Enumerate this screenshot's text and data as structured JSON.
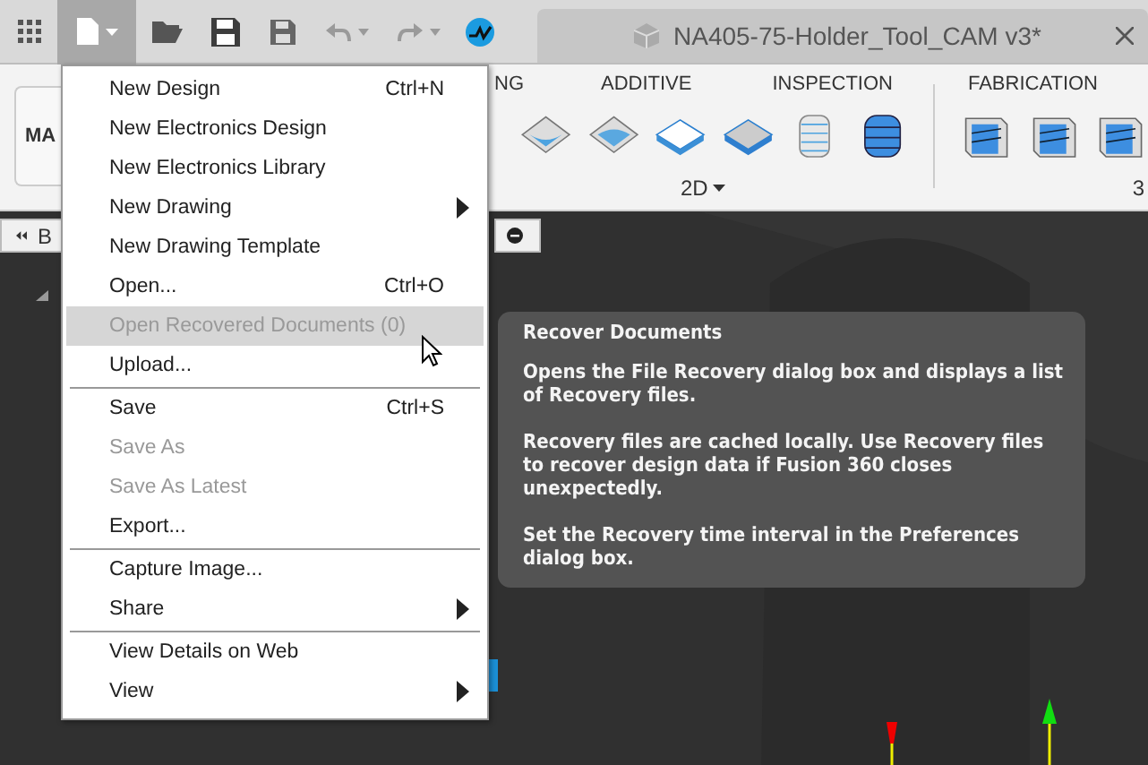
{
  "toolbar": {
    "document_tab": "NA405-75-Holder_Tool_CAM v3*"
  },
  "ribbon": {
    "workspace_button": "MA",
    "tabs": [
      {
        "label": "NG"
      },
      {
        "label": "ADDITIVE"
      },
      {
        "label": "INSPECTION"
      },
      {
        "label": "FABRICATION"
      }
    ],
    "groups": [
      {
        "label": "2D",
        "dropdown": true
      },
      {
        "label": "3",
        "dropdown": false
      }
    ]
  },
  "browser": {
    "label": "B"
  },
  "menu": {
    "items": [
      {
        "kind": "item",
        "label": "New Design",
        "shortcut": "Ctrl+N",
        "disabled": false,
        "selected": false,
        "submenu": false
      },
      {
        "kind": "item",
        "label": "New Electronics Design",
        "disabled": false,
        "selected": false,
        "submenu": false
      },
      {
        "kind": "item",
        "label": "New Electronics Library",
        "disabled": false,
        "selected": false,
        "submenu": false
      },
      {
        "kind": "item",
        "label": "New Drawing",
        "disabled": false,
        "selected": false,
        "submenu": true
      },
      {
        "kind": "item",
        "label": "New Drawing Template",
        "disabled": false,
        "selected": false,
        "submenu": false
      },
      {
        "kind": "item",
        "label": "Open...",
        "shortcut": "Ctrl+O",
        "disabled": false,
        "selected": false,
        "submenu": false
      },
      {
        "kind": "item",
        "label": "Open Recovered Documents (0)",
        "disabled": true,
        "selected": true,
        "submenu": false
      },
      {
        "kind": "item",
        "label": "Upload...",
        "disabled": false,
        "selected": false,
        "submenu": false
      },
      {
        "kind": "separator"
      },
      {
        "kind": "item",
        "label": "Save",
        "shortcut": "Ctrl+S",
        "disabled": false,
        "selected": false,
        "submenu": false
      },
      {
        "kind": "item",
        "label": "Save As",
        "disabled": true,
        "selected": false,
        "submenu": false
      },
      {
        "kind": "item",
        "label": "Save As Latest",
        "disabled": true,
        "selected": false,
        "submenu": false
      },
      {
        "kind": "item",
        "label": "Export...",
        "disabled": false,
        "selected": false,
        "submenu": false
      },
      {
        "kind": "separator"
      },
      {
        "kind": "item",
        "label": "Capture Image...",
        "disabled": false,
        "selected": false,
        "submenu": false
      },
      {
        "kind": "item",
        "label": "Share",
        "disabled": false,
        "selected": false,
        "submenu": true
      },
      {
        "kind": "separator"
      },
      {
        "kind": "item",
        "label": "View Details on Web",
        "disabled": false,
        "selected": false,
        "submenu": false
      },
      {
        "kind": "item",
        "label": "View",
        "disabled": false,
        "selected": false,
        "submenu": true
      }
    ]
  },
  "tooltip": {
    "title": "Recover Documents",
    "paragraphs": [
      "Opens the File Recovery dialog box and displays a list of Recovery files.",
      "Recovery files are cached locally. Use Recovery files to recover design data if Fusion 360 closes unexpectedly.",
      "Set the Recovery time interval in the Preferences dialog box."
    ]
  }
}
